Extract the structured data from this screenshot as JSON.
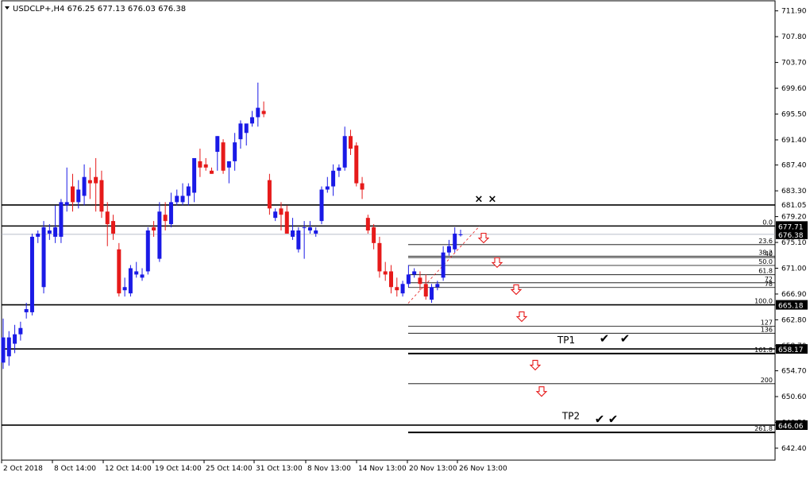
{
  "header": {
    "symbol_info": "USDCLP+,H4  676.25 677.13 676.03 676.38"
  },
  "colors": {
    "bull": "#1a1ae6",
    "bear": "#e61a1a",
    "line": "#000000",
    "arrow": "#e61a1a",
    "grid": "#000000",
    "current_price_bg": "#000000"
  },
  "chart_data": {
    "type": "candlestick",
    "title": "",
    "xlabel": "",
    "ylabel": "",
    "ylim": [
      640.5,
      713.5
    ],
    "y_ticks": [
      "711.90",
      "707.80",
      "703.70",
      "699.60",
      "695.50",
      "691.40",
      "687.40",
      "683.30",
      "679.20",
      "675.10",
      "671.00",
      "666.90",
      "662.80",
      "658.70",
      "654.70",
      "650.60",
      "646.50",
      "642.40"
    ],
    "x_ticks": [
      "2 Oct 2018",
      "8 Oct 14:00",
      "12 Oct 14:00",
      "19 Oct 14:00",
      "25 Oct 14:00",
      "31 Oct 13:00",
      "8 Nov 13:00",
      "14 Nov 13:00",
      "20 Nov 13:00",
      "26 Nov 13:00"
    ],
    "price_labels": [
      {
        "label": "681.05",
        "value": 681.05,
        "highlight": false
      },
      {
        "label": "677.71",
        "value": 677.71,
        "highlight": true
      },
      {
        "label": "676.38",
        "value": 676.38,
        "highlight": true
      },
      {
        "label": "665.18",
        "value": 665.18,
        "highlight": true
      },
      {
        "label": "658.17",
        "value": 658.17,
        "highlight": true
      },
      {
        "label": "646.06",
        "value": 646.06,
        "highlight": true
      }
    ],
    "horizontal_levels": [
      681.05,
      677.71,
      665.18,
      658.17,
      646.06
    ],
    "fibonacci": {
      "high": 677.71,
      "low": 665.18,
      "levels": [
        {
          "label": "0.0",
          "ratio": 0.0
        },
        {
          "label": "23.6",
          "ratio": 0.236
        },
        {
          "label": "38.2",
          "ratio": 0.382
        },
        {
          "label": "40",
          "ratio": 0.4
        },
        {
          "label": "50.0",
          "ratio": 0.5
        },
        {
          "label": "61.8",
          "ratio": 0.618
        },
        {
          "label": "72",
          "ratio": 0.72
        },
        {
          "label": "78",
          "ratio": 0.78
        },
        {
          "label": "100.0",
          "ratio": 1.0
        },
        {
          "label": "127",
          "ratio": 1.27
        },
        {
          "label": "136",
          "ratio": 1.36
        },
        {
          "label": "161.8",
          "ratio": 1.618
        },
        {
          "label": "200",
          "ratio": 2.0
        },
        {
          "label": "261.8",
          "ratio": 2.618
        }
      ]
    },
    "annotations": [
      {
        "text": "TP1",
        "value": 659.6
      },
      {
        "text": "TP2",
        "value": 647.5
      }
    ],
    "candles": [
      {
        "o": 656.0,
        "h": 663.0,
        "l": 655.0,
        "c": 660.0
      },
      {
        "o": 657.0,
        "h": 661.0,
        "l": 655.5,
        "c": 660.0
      },
      {
        "o": 659.0,
        "h": 662.0,
        "l": 657.5,
        "c": 660.5
      },
      {
        "o": 660.5,
        "h": 662.5,
        "l": 659.5,
        "c": 661.5
      },
      {
        "o": 664.0,
        "h": 665.5,
        "l": 663.0,
        "c": 664.5
      },
      {
        "o": 664.0,
        "h": 676.5,
        "l": 663.5,
        "c": 676.0
      },
      {
        "o": 676.0,
        "h": 677.0,
        "l": 675.0,
        "c": 676.5
      },
      {
        "o": 668.0,
        "h": 678.5,
        "l": 667.0,
        "c": 677.5
      },
      {
        "o": 676.5,
        "h": 678.0,
        "l": 675.5,
        "c": 677.0
      },
      {
        "o": 676.0,
        "h": 681.0,
        "l": 675.0,
        "c": 677.5
      },
      {
        "o": 676.0,
        "h": 682.0,
        "l": 675.0,
        "c": 681.5
      },
      {
        "o": 681.0,
        "h": 687.0,
        "l": 680.0,
        "c": 681.5
      },
      {
        "o": 684.0,
        "h": 686.0,
        "l": 680.0,
        "c": 681.5
      },
      {
        "o": 681.5,
        "h": 685.0,
        "l": 680.5,
        "c": 683.5
      },
      {
        "o": 682.5,
        "h": 687.5,
        "l": 681.0,
        "c": 685.5
      },
      {
        "o": 685.0,
        "h": 687.0,
        "l": 682.0,
        "c": 684.5
      },
      {
        "o": 685.5,
        "h": 688.5,
        "l": 680.0,
        "c": 684.5
      },
      {
        "o": 685.0,
        "h": 686.5,
        "l": 679.0,
        "c": 680.0
      },
      {
        "o": 680.0,
        "h": 681.5,
        "l": 674.5,
        "c": 678.0
      },
      {
        "o": 678.5,
        "h": 679.5,
        "l": 675.5,
        "c": 676.5
      },
      {
        "o": 674.0,
        "h": 675.0,
        "l": 666.5,
        "c": 667.0
      },
      {
        "o": 667.5,
        "h": 669.5,
        "l": 666.5,
        "c": 668.0
      },
      {
        "o": 667.0,
        "h": 671.5,
        "l": 666.5,
        "c": 671.0
      },
      {
        "o": 670.0,
        "h": 672.0,
        "l": 669.5,
        "c": 670.5
      },
      {
        "o": 669.5,
        "h": 671.0,
        "l": 669.0,
        "c": 670.0
      },
      {
        "o": 670.5,
        "h": 677.5,
        "l": 670.0,
        "c": 677.0
      },
      {
        "o": 677.5,
        "h": 678.5,
        "l": 676.0,
        "c": 677.0
      },
      {
        "o": 672.5,
        "h": 681.5,
        "l": 672.0,
        "c": 680.0
      },
      {
        "o": 679.5,
        "h": 681.5,
        "l": 677.0,
        "c": 678.5
      },
      {
        "o": 678.0,
        "h": 683.0,
        "l": 677.5,
        "c": 681.5
      },
      {
        "o": 681.5,
        "h": 683.5,
        "l": 681.0,
        "c": 682.5
      },
      {
        "o": 681.5,
        "h": 684.5,
        "l": 681.0,
        "c": 682.5
      },
      {
        "o": 682.5,
        "h": 684.5,
        "l": 681.0,
        "c": 684.0
      },
      {
        "o": 683.0,
        "h": 687.5,
        "l": 681.5,
        "c": 688.5
      },
      {
        "o": 688.0,
        "h": 690.0,
        "l": 685.5,
        "c": 687.0
      },
      {
        "o": 687.5,
        "h": 688.5,
        "l": 686.5,
        "c": 687.0
      },
      {
        "o": 686.5,
        "h": 687.0,
        "l": 686.0,
        "c": 686.0
      },
      {
        "o": 689.5,
        "h": 692.0,
        "l": 686.5,
        "c": 692.0
      },
      {
        "o": 691.0,
        "h": 691.5,
        "l": 686.0,
        "c": 686.5
      },
      {
        "o": 687.0,
        "h": 688.0,
        "l": 684.5,
        "c": 688.0
      },
      {
        "o": 688.0,
        "h": 692.5,
        "l": 686.5,
        "c": 691.0
      },
      {
        "o": 691.5,
        "h": 694.5,
        "l": 690.0,
        "c": 694.0
      },
      {
        "o": 692.5,
        "h": 693.5,
        "l": 690.5,
        "c": 694.0
      },
      {
        "o": 694.0,
        "h": 696.0,
        "l": 693.5,
        "c": 695.0
      },
      {
        "o": 695.0,
        "h": 700.5,
        "l": 693.5,
        "c": 696.5
      },
      {
        "o": 696.0,
        "h": 697.5,
        "l": 695.0,
        "c": 695.5
      },
      {
        "o": 685.0,
        "h": 686.0,
        "l": 679.5,
        "c": 680.5
      },
      {
        "o": 679.0,
        "h": 680.5,
        "l": 678.5,
        "c": 680.0
      },
      {
        "o": 680.5,
        "h": 681.5,
        "l": 677.0,
        "c": 679.5
      },
      {
        "o": 680.0,
        "h": 681.0,
        "l": 676.5,
        "c": 676.5
      },
      {
        "o": 676.0,
        "h": 679.0,
        "l": 675.5,
        "c": 677.0
      },
      {
        "o": 674.0,
        "h": 677.5,
        "l": 673.5,
        "c": 677.0
      },
      {
        "o": 677.5,
        "h": 678.5,
        "l": 672.5,
        "c": 677.5
      },
      {
        "o": 677.0,
        "h": 678.5,
        "l": 676.5,
        "c": 677.5
      },
      {
        "o": 676.5,
        "h": 677.5,
        "l": 676.0,
        "c": 677.0
      },
      {
        "o": 678.5,
        "h": 684.0,
        "l": 678.0,
        "c": 683.5
      },
      {
        "o": 683.5,
        "h": 685.5,
        "l": 683.0,
        "c": 684.0
      },
      {
        "o": 684.0,
        "h": 687.5,
        "l": 682.5,
        "c": 686.5
      },
      {
        "o": 686.5,
        "h": 687.5,
        "l": 685.5,
        "c": 687.0
      },
      {
        "o": 687.0,
        "h": 693.5,
        "l": 686.5,
        "c": 692.0
      },
      {
        "o": 692.0,
        "h": 693.0,
        "l": 689.0,
        "c": 690.0
      },
      {
        "o": 690.5,
        "h": 691.0,
        "l": 684.0,
        "c": 684.5
      },
      {
        "o": 684.5,
        "h": 685.5,
        "l": 682.0,
        "c": 683.5
      },
      {
        "o": 679.0,
        "h": 679.5,
        "l": 676.5,
        "c": 677.0
      },
      {
        "o": 677.5,
        "h": 678.0,
        "l": 674.0,
        "c": 675.0
      },
      {
        "o": 675.0,
        "h": 676.0,
        "l": 669.5,
        "c": 670.5
      },
      {
        "o": 670.5,
        "h": 672.0,
        "l": 669.0,
        "c": 670.0
      },
      {
        "o": 670.5,
        "h": 671.5,
        "l": 667.0,
        "c": 668.0
      },
      {
        "o": 668.0,
        "h": 669.5,
        "l": 666.5,
        "c": 667.5
      },
      {
        "o": 667.0,
        "h": 669.0,
        "l": 666.5,
        "c": 668.5
      },
      {
        "o": 668.5,
        "h": 671.5,
        "l": 668.0,
        "c": 670.0
      },
      {
        "o": 670.0,
        "h": 671.0,
        "l": 669.5,
        "c": 670.5
      },
      {
        "o": 669.5,
        "h": 670.5,
        "l": 667.5,
        "c": 668.5
      },
      {
        "o": 668.5,
        "h": 670.0,
        "l": 666.0,
        "c": 666.5
      },
      {
        "o": 666.0,
        "h": 668.5,
        "l": 665.5,
        "c": 668.0
      },
      {
        "o": 668.0,
        "h": 669.0,
        "l": 667.5,
        "c": 668.5
      },
      {
        "o": 669.5,
        "h": 674.5,
        "l": 669.0,
        "c": 673.5
      },
      {
        "o": 673.5,
        "h": 675.5,
        "l": 673.0,
        "c": 674.5
      },
      {
        "o": 674.0,
        "h": 677.5,
        "l": 673.5,
        "c": 676.5
      },
      {
        "o": 676.25,
        "h": 677.13,
        "l": 676.03,
        "c": 676.38
      }
    ],
    "down_arrows": [
      {
        "value": 675.8
      },
      {
        "value": 671.9
      },
      {
        "value": 667.6
      },
      {
        "value": 663.3
      },
      {
        "value": 655.6
      },
      {
        "value": 651.4
      }
    ],
    "crosses": [
      {
        "value": 682.0
      }
    ],
    "checks_tp1": {
      "value": 659.8
    },
    "checks_tp2": {
      "value": 647.0
    }
  }
}
